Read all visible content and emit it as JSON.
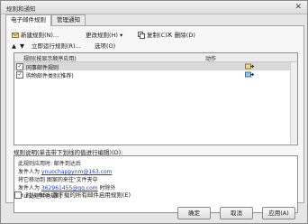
{
  "window": {
    "title": "规则和通知",
    "close_glyph": "✕"
  },
  "tabs": [
    {
      "label": "电子邮件规则"
    },
    {
      "label": "管理通知"
    }
  ],
  "toolbar": {
    "new_rule": "新建规则(N)...",
    "change_rule": "更改规则(H)",
    "copy": "复制(C)...",
    "delete": "删除(D)",
    "run_now": "立即运行规则(R)...",
    "options": "选项(O)"
  },
  "rules_table": {
    "col_rule": "规则(按显示顺序应用)",
    "col_action": "动作",
    "rows": [
      {
        "label": "同事邮件规则",
        "checked": true,
        "selected": true
      },
      {
        "label": "购物邮件类别(推荐)",
        "checked": true,
        "selected": false
      }
    ]
  },
  "description": {
    "label": "规则说明(单击带下划线的值进行编辑)(D):",
    "lines": [
      {
        "text": "此规则应用时: 邮件到达后"
      },
      {
        "prefix": "发件人为 ",
        "link": "ynuochappynm@163.com"
      },
      {
        "text": "将它移动到 图案的来往\"文件夹中"
      },
      {
        "prefix": "发件人为 ",
        "link": "362961455@qq.com",
        "suffix": " 时除外"
      },
      {
        "text": "停止处理其他规则"
      }
    ]
  },
  "rss_checkbox": {
    "label": "对从 RSS 源下载的所有邮件启用规则(E)",
    "checked": false
  },
  "buttons": {
    "ok": "确定",
    "cancel": "取消",
    "apply": "应用(A)"
  }
}
